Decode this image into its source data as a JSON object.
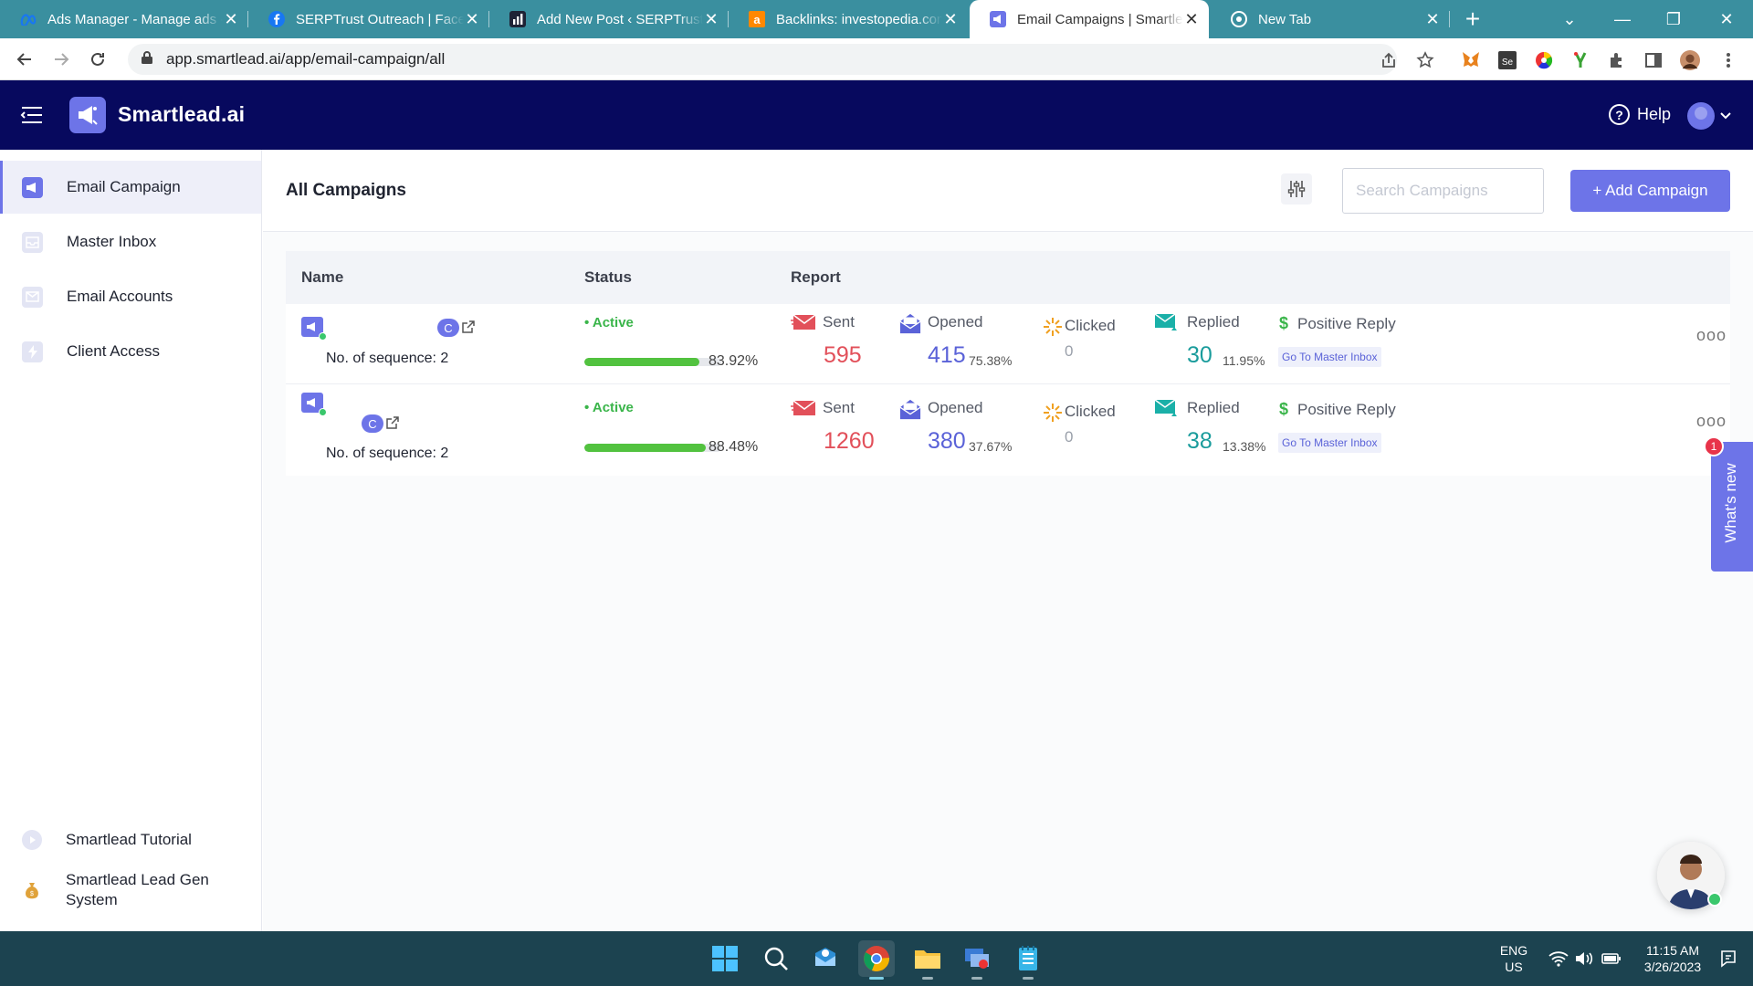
{
  "browser": {
    "tabs": [
      {
        "title": "Ads Manager - Manage ads - Campaigns",
        "icon": "meta-icon"
      },
      {
        "title": "SERPTrust Outreach | Facebook",
        "icon": "facebook-icon"
      },
      {
        "title": "Add New Post ‹ SERPTrust — WordPress",
        "icon": "chart-icon"
      },
      {
        "title": "Backlinks: investopedia.com",
        "icon": "ahrefs-icon"
      },
      {
        "title": "Email Campaigns | Smartlead",
        "icon": "smartlead-icon",
        "active": true
      },
      {
        "title": "New Tab",
        "icon": "chrome-icon"
      }
    ],
    "url": "app.smartlead.ai/app/email-campaign/all"
  },
  "header": {
    "brand": "Smartlead.ai",
    "help": "Help"
  },
  "sidebar": {
    "items": [
      {
        "label": "Email Campaign",
        "icon": "megaphone-icon",
        "active": true
      },
      {
        "label": "Master Inbox",
        "icon": "inbox-icon"
      },
      {
        "label": "Email Accounts",
        "icon": "mail-icon"
      },
      {
        "label": "Client Access",
        "icon": "bolt-icon"
      }
    ],
    "bottom": [
      {
        "label": "Smartlead Tutorial",
        "icon": "play-icon"
      },
      {
        "label": "Smartlead Lead Gen System",
        "icon": "money-bag-icon"
      }
    ]
  },
  "main": {
    "title": "All Campaigns",
    "search_placeholder": "Search Campaigns",
    "add_button": "+ Add Campaign",
    "columns": {
      "name": "Name",
      "status": "Status",
      "report": "Report"
    },
    "labels": {
      "sequence_prefix": "No. of sequence:",
      "sent": "Sent",
      "opened": "Opened",
      "clicked": "Clicked",
      "replied": "Replied",
      "positive_reply": "Positive Reply",
      "master_inbox": "Go To Master Inbox",
      "client_badge": "C",
      "more": "ooo"
    },
    "campaigns": [
      {
        "sequences": "2",
        "status": "• Active",
        "progress": 83.92,
        "progress_label": "83.92%",
        "sent": "595",
        "opened": "415",
        "opened_pct": "75.38%",
        "clicked": "0",
        "replied": "30",
        "replied_pct": "11.95%"
      },
      {
        "sequences": "2",
        "status": "• Active",
        "progress": 88.48,
        "progress_label": "88.48%",
        "sent": "1260",
        "opened": "380",
        "opened_pct": "37.67%",
        "clicked": "0",
        "replied": "38",
        "replied_pct": "13.38%"
      }
    ]
  },
  "widgets": {
    "whats_new": "What's new",
    "whats_new_badge": "1"
  },
  "taskbar": {
    "lang": "ENG",
    "region": "US",
    "time": "11:15 AM",
    "date": "3/26/2023"
  },
  "colors": {
    "brand_dark": "#07095e",
    "accent": "#6d74e8",
    "sent": "#e2505a",
    "replied": "#1a9c9c",
    "active_status": "#3ab54a"
  }
}
